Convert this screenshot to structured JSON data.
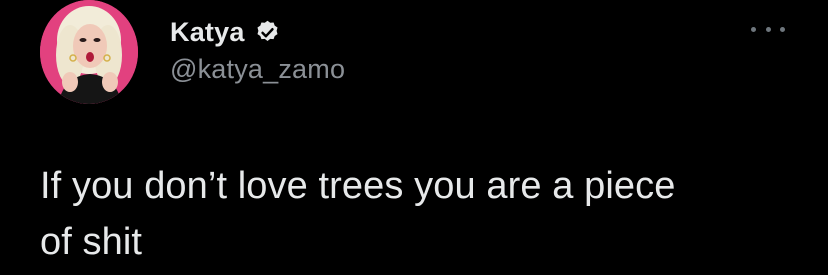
{
  "tweet": {
    "author": {
      "display_name": "Katya",
      "handle": "@katya_zamo",
      "verified": true,
      "avatar": "profile-photo"
    },
    "text": "If you don’t love trees you are a piece\nof shit",
    "more_icon": "ellipsis-icon"
  },
  "colors": {
    "background": "#000000",
    "text_primary": "#e7e9ea",
    "text_secondary": "#8b9096",
    "avatar_bg": "#e2417f"
  }
}
